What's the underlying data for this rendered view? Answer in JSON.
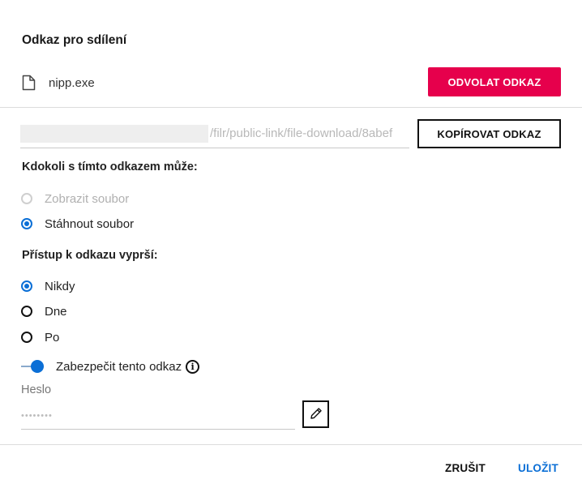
{
  "dialog": {
    "title": "Odkaz pro sdílení"
  },
  "file": {
    "name": "nipp.exe",
    "icon": "file-icon"
  },
  "revoke_button": "ODVOLAT ODKAZ",
  "link": {
    "value": "/filr/public-link/file-download/8abef",
    "copy_button": "KOPÍROVAT ODKAZ"
  },
  "permissions": {
    "label": "Kdokoli s tímto odkazem může:",
    "options": [
      {
        "label": "Zobrazit soubor",
        "checked": false,
        "disabled": true
      },
      {
        "label": "Stáhnout soubor",
        "checked": true,
        "disabled": false
      }
    ]
  },
  "expiration": {
    "label": "Přístup k odkazu vyprší:",
    "options": [
      {
        "label": "Nikdy",
        "checked": true
      },
      {
        "label": "Dne",
        "checked": false
      },
      {
        "label": "Po",
        "checked": false
      }
    ]
  },
  "secure": {
    "label": "Zabezpečit tento odkaz",
    "enabled": true,
    "info_icon": "info-icon"
  },
  "password": {
    "label": "Heslo",
    "masked_value": "••••••••",
    "edit_icon": "pencil-icon"
  },
  "footer": {
    "cancel": "ZRUŠIT",
    "save": "ULOŽIT"
  },
  "colors": {
    "accent_blue": "#0b6fd6",
    "revoke_red": "#e6004c"
  }
}
